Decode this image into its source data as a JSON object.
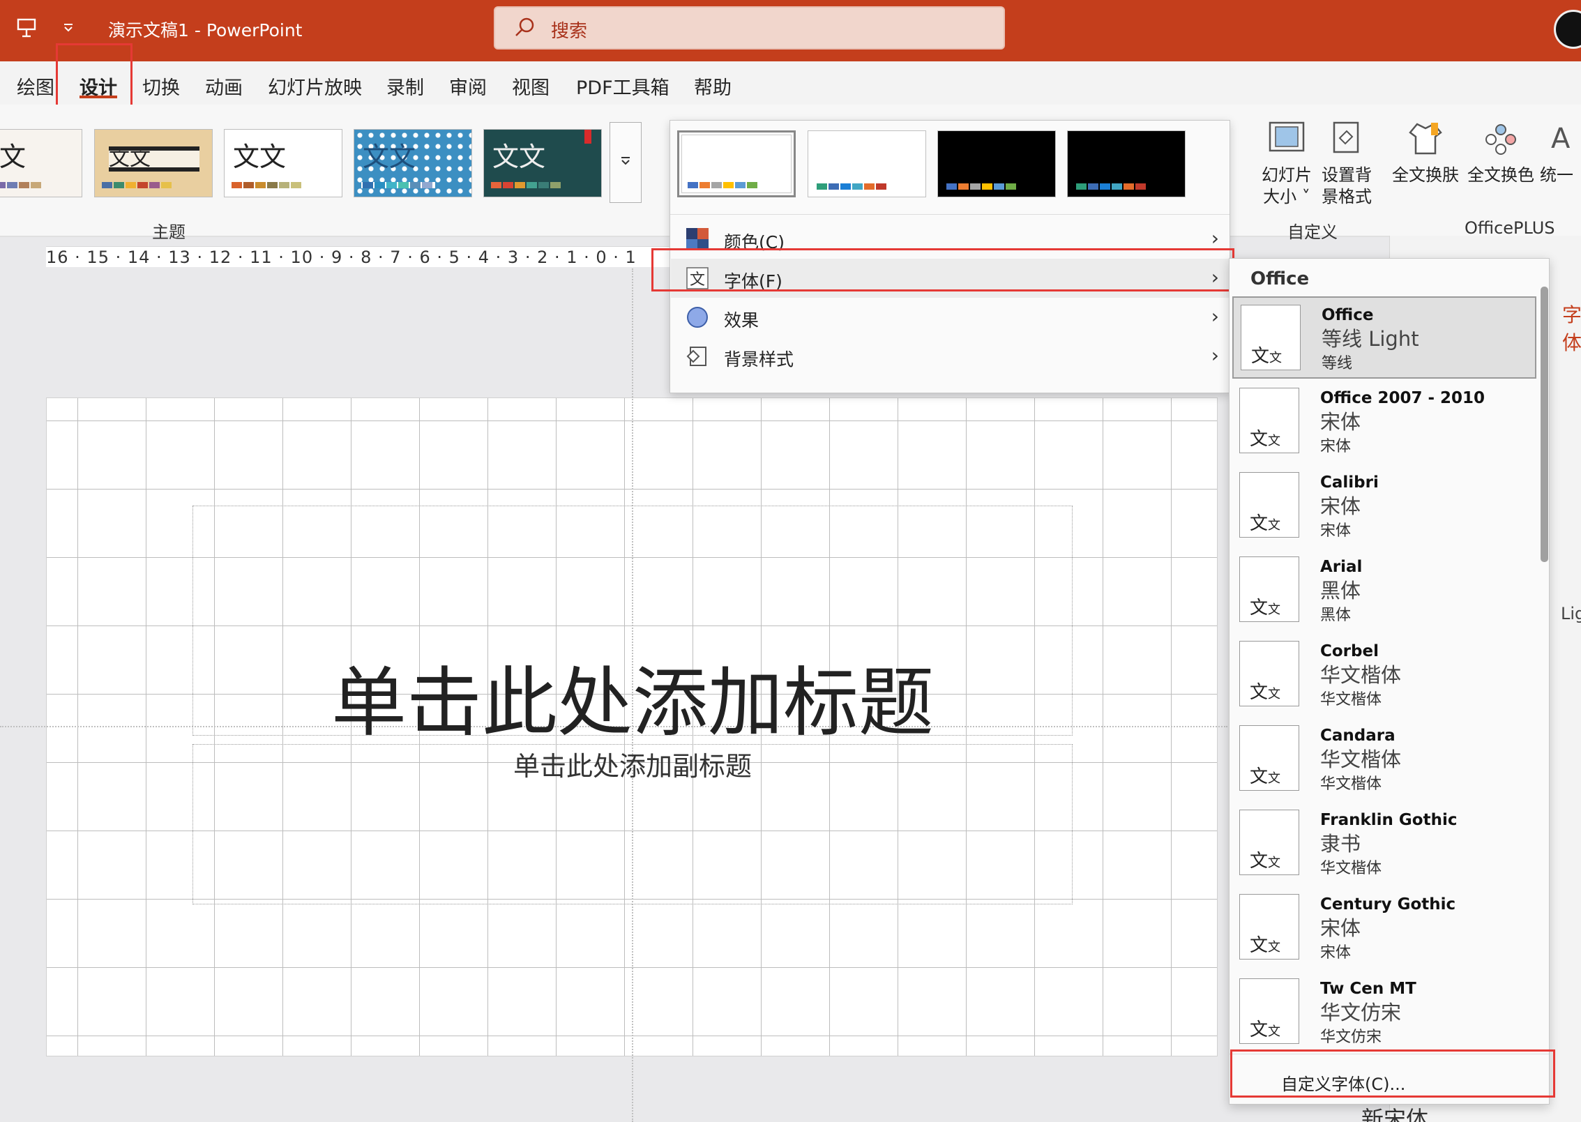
{
  "app": {
    "doc_title": "演示文稿1  -  PowerPoint",
    "search_placeholder": "搜索",
    "accent": "#c43e1c"
  },
  "tabs": [
    "绘图",
    "设计",
    "切换",
    "动画",
    "幻灯片放映",
    "录制",
    "审阅",
    "视图",
    "PDF工具箱",
    "帮助"
  ],
  "themes": {
    "group_label": "主题",
    "items": [
      {
        "text": "文文",
        "colors": [
          "#b48cc7",
          "#a880c0",
          "#7a6aa8",
          "#6f7db3",
          "#b1805a",
          "#c7a878"
        ]
      },
      {
        "text": "文文",
        "colors": [
          "#4a6fa5",
          "#3c8b6d",
          "#f0b030",
          "#c4452c",
          "#9a5c8c",
          "#e6c04a"
        ]
      },
      {
        "text": "文文",
        "colors": [
          "#d9622b",
          "#b05d2a",
          "#c98c2d",
          "#8a7a49",
          "#b7b27a",
          "#c9c07a"
        ]
      },
      {
        "text": "文文",
        "colors": [
          "#3070b0",
          "#2a8fc2",
          "#41b4c8",
          "#4bc1b1",
          "#5a8fb9",
          "#90a8d0"
        ]
      },
      {
        "text": "文文",
        "colors": [
          "#e7643b",
          "#d94333",
          "#e1992f",
          "#43a191",
          "#3a7d77",
          "#8fa06b"
        ]
      }
    ]
  },
  "variants": [
    {
      "bg": "#ffffff",
      "colors": [
        "#4472c4",
        "#ed7d31",
        "#a5a5a5",
        "#ffc000",
        "#5b9bd5",
        "#70ad47"
      ]
    },
    {
      "bg": "#ffffff",
      "colors": [
        "#2e9e7a",
        "#3d6db5",
        "#1b7fd6",
        "#41a6c4",
        "#e36c2b",
        "#c0392b"
      ]
    },
    {
      "bg": "#000000",
      "colors": [
        "#4472c4",
        "#ed7d31",
        "#a5a5a5",
        "#ffc000",
        "#5b9bd5",
        "#70ad47"
      ]
    },
    {
      "bg": "#000000",
      "colors": [
        "#2e9e7a",
        "#3d6db5",
        "#1b7fd6",
        "#41a6c4",
        "#e36c2b",
        "#c0392b"
      ]
    }
  ],
  "variant_menu": [
    {
      "label": "颜色(C)",
      "icon": "color-palette-icon"
    },
    {
      "label": "字体(F)",
      "icon": "font-icon"
    },
    {
      "label": "效果",
      "icon": "effects-icon"
    },
    {
      "label": "背景样式",
      "icon": "background-style-icon"
    }
  ],
  "custom_group": {
    "label": "自定义",
    "slide_size": "幻灯片\n大小 ˅",
    "bg_format": "设置背\n景格式"
  },
  "officeplus_group": {
    "label": "OfficePLUS",
    "skin": "全文换肤",
    "color": "全文换色",
    "unify": "统一"
  },
  "ruler": "16 · 15 · 14 · 13 · 12 · 11 · 10 · 9 · 8 · 7 · 6 · 5 · 4 · 3 · 2 · 1 · 0 · 1",
  "slide": {
    "title": "单击此处添加标题",
    "subtitle": "单击此处添加副标题"
  },
  "font_panel": {
    "header": "Office",
    "custom_label": "自定义字体(C)...",
    "preview_text": "文",
    "preview_small": "文",
    "entries": [
      {
        "name": "Office",
        "heading": "等线 Light",
        "body": "等线"
      },
      {
        "name": "Office 2007 - 2010",
        "heading": "宋体",
        "body": "宋体"
      },
      {
        "name": "Calibri",
        "heading": "宋体",
        "body": "宋体"
      },
      {
        "name": "Arial",
        "heading": "黑体",
        "body": "黑体"
      },
      {
        "name": "Corbel",
        "heading": "华文楷体",
        "body": "华文楷体"
      },
      {
        "name": "Candara",
        "heading": "华文楷体",
        "body": "华文楷体"
      },
      {
        "name": "Franklin Gothic",
        "heading": "隶书",
        "body": "华文楷体"
      },
      {
        "name": "Century Gothic",
        "heading": "宋体",
        "body": "宋体"
      },
      {
        "name": "Tw Cen MT",
        "heading": "华文仿宋",
        "body": "华文仿宋"
      }
    ]
  },
  "side_pane": {
    "stub_top": "字体",
    "stub_mid": "Lig",
    "stub_bottom": "新宋体"
  }
}
